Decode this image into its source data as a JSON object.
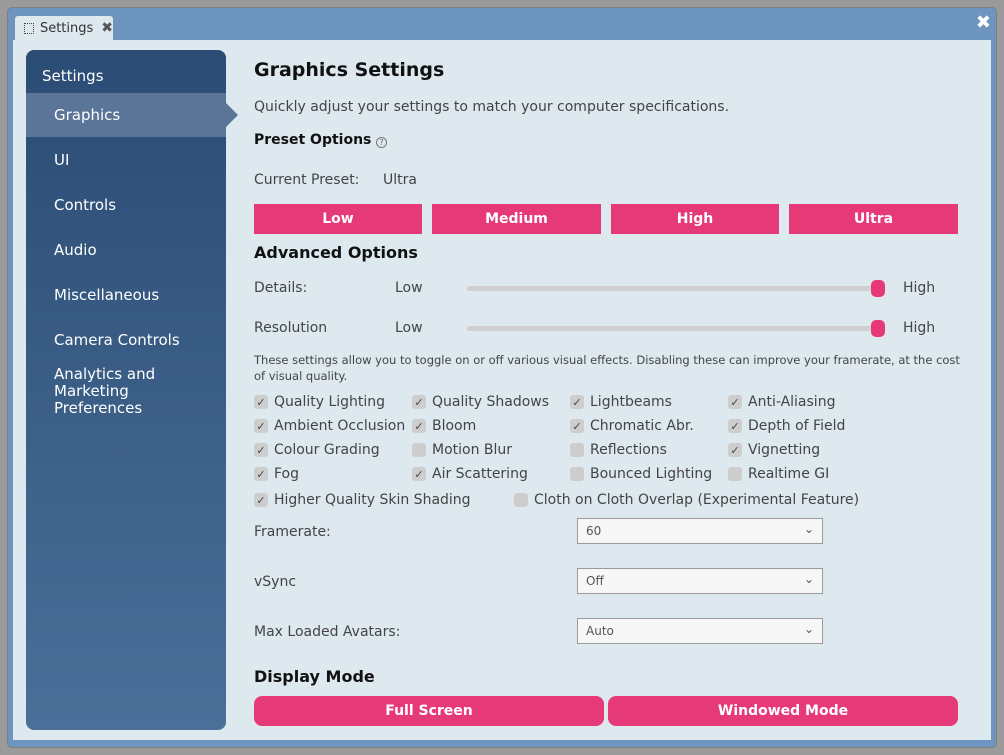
{
  "window": {
    "tab_label": "Settings",
    "close_symbol": "✖",
    "tab_close_symbol": "✖"
  },
  "sidebar": {
    "title": "Settings",
    "items": [
      {
        "label": "Graphics"
      },
      {
        "label": "UI"
      },
      {
        "label": "Controls"
      },
      {
        "label": "Audio"
      },
      {
        "label": "Miscellaneous"
      },
      {
        "label": "Camera Controls"
      },
      {
        "label": "Analytics and Marketing Preferences"
      }
    ]
  },
  "main": {
    "title": "Graphics Settings",
    "subtitle": "Quickly adjust your settings to match your computer specifications.",
    "preset_title": "Preset Options",
    "help_symbol": "?",
    "current_preset_label": "Current Preset:",
    "current_preset_value": "Ultra",
    "preset_buttons": [
      "Low",
      "Medium",
      "High",
      "Ultra"
    ],
    "advanced_title": "Advanced Options",
    "sliders": [
      {
        "label": "Details:",
        "low": "Low",
        "high": "High",
        "value": 1.0
      },
      {
        "label": "Resolution",
        "low": "Low",
        "high": "High",
        "value": 1.0
      }
    ],
    "note": "These settings allow you to toggle on or off various visual effects. Disabling these can improve your framerate, at the cost of visual quality.",
    "checkboxes": [
      {
        "label": "Quality Lighting",
        "checked": true
      },
      {
        "label": "Quality Shadows",
        "checked": true
      },
      {
        "label": "Lightbeams",
        "checked": true
      },
      {
        "label": "Anti-Aliasing",
        "checked": true
      },
      {
        "label": "Ambient Occlusion",
        "checked": true
      },
      {
        "label": "Bloom",
        "checked": true
      },
      {
        "label": "Chromatic Abr.",
        "checked": true
      },
      {
        "label": "Depth of Field",
        "checked": true
      },
      {
        "label": "Colour Grading",
        "checked": true
      },
      {
        "label": "Motion Blur",
        "checked": false
      },
      {
        "label": "Reflections",
        "checked": false
      },
      {
        "label": "Vignetting",
        "checked": true
      },
      {
        "label": "Fog",
        "checked": true
      },
      {
        "label": "Air Scattering",
        "checked": true
      },
      {
        "label": "Bounced Lighting",
        "checked": false
      },
      {
        "label": "Realtime GI",
        "checked": false
      },
      {
        "label": "Higher Quality Skin Shading",
        "checked": true
      },
      {
        "label": "Cloth on Cloth Overlap (Experimental Feature)",
        "checked": false
      }
    ],
    "check_symbol": "✓",
    "chevron_symbol": "⌄",
    "selects": [
      {
        "label": "Framerate:",
        "value": "60"
      },
      {
        "label": "vSync",
        "value": "Off"
      },
      {
        "label": "Max Loaded Avatars:",
        "value": "Auto"
      }
    ],
    "display_title": "Display Mode",
    "display_buttons": [
      "Full Screen",
      "Windowed Mode"
    ]
  },
  "colors": {
    "accent": "#e63a78",
    "sidebar_top": "#2b4c74",
    "sidebar_bottom": "#4a6f98",
    "panel": "#dde9ef",
    "frame": "#6e95c0"
  }
}
